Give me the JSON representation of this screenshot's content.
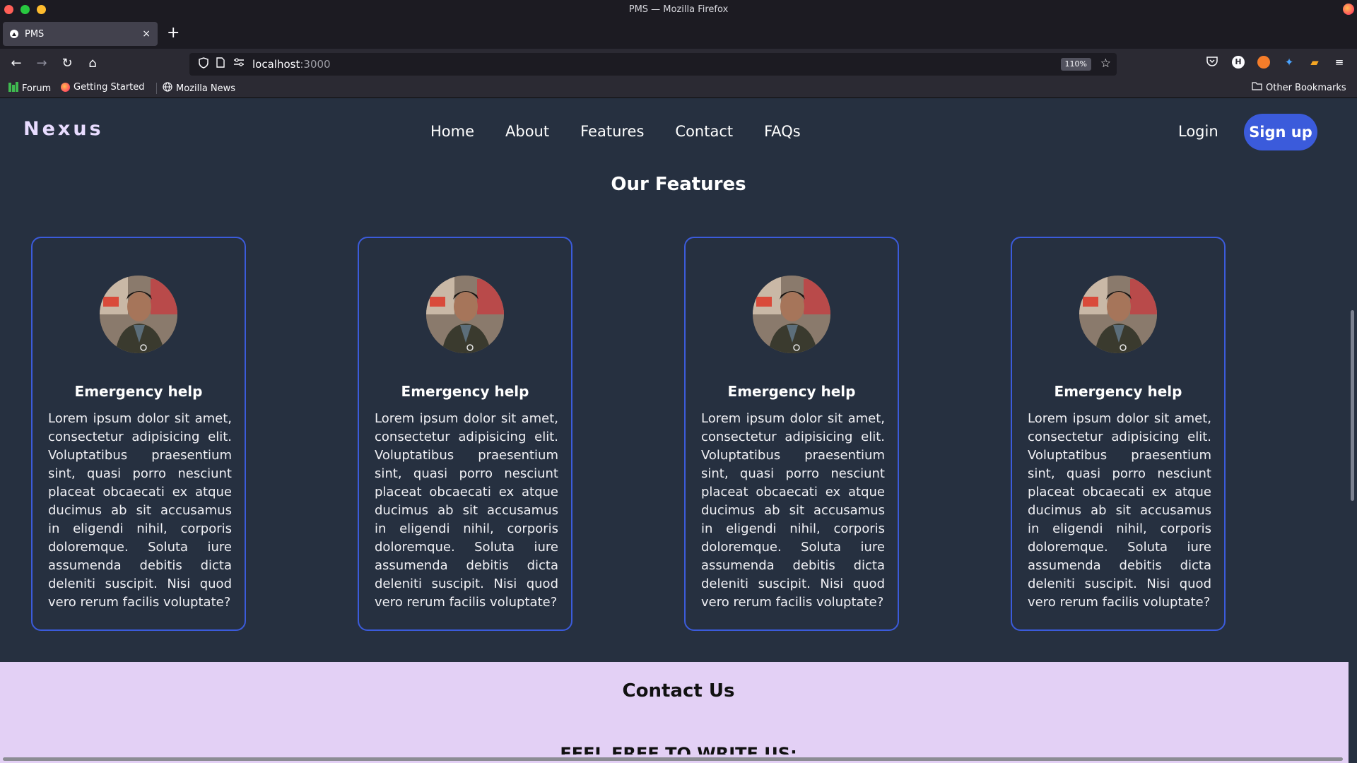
{
  "window": {
    "title": "PMS — Mozilla Firefox"
  },
  "tab": {
    "title": "PMS",
    "close": "×",
    "new_tab": "+"
  },
  "address": {
    "host": "localhost",
    "port": ":3000",
    "zoom": "110%"
  },
  "bookmarks": [
    {
      "label": "Forum"
    },
    {
      "label": "Getting Started"
    },
    {
      "label": "Mozilla News"
    }
  ],
  "other_bookmarks": "Other Bookmarks",
  "site": {
    "logo": "Nexus",
    "nav": [
      "Home",
      "About",
      "Features",
      "Contact",
      "FAQs"
    ],
    "login": "Login",
    "signup": "Sign up"
  },
  "features": {
    "title": "Our Features",
    "cards": [
      {
        "title": "Emergency help",
        "text": "Lorem ipsum dolor sit amet, consectetur adipisicing elit. Voluptatibus praesentium sint, quasi porro nesciunt placeat obcaecati ex atque ducimus ab sit accusamus in eligendi nihil, corporis doloremque. Soluta iure assumenda debitis dicta deleniti suscipit. Nisi quod vero rerum facilis voluptate?"
      },
      {
        "title": "Emergency help",
        "text": "Lorem ipsum dolor sit amet, consectetur adipisicing elit. Voluptatibus praesentium sint, quasi porro nesciunt placeat obcaecati ex atque ducimus ab sit accusamus in eligendi nihil, corporis doloremque. Soluta iure assumenda debitis dicta deleniti suscipit. Nisi quod vero rerum facilis voluptate?"
      },
      {
        "title": "Emergency help",
        "text": "Lorem ipsum dolor sit amet, consectetur adipisicing elit. Voluptatibus praesentium sint, quasi porro nesciunt placeat obcaecati ex atque ducimus ab sit accusamus in eligendi nihil, corporis doloremque. Soluta iure assumenda debitis dicta deleniti suscipit. Nisi quod vero rerum facilis voluptate?"
      },
      {
        "title": "Emergency help",
        "text": "Lorem ipsum dolor sit amet, consectetur adipisicing elit. Voluptatibus praesentium sint, quasi porro nesciunt placeat obcaecati ex atque ducimus ab sit accusamus in eligendi nihil, corporis doloremque. Soluta iure assumenda debitis dicta deleniti suscipit. Nisi quod vero rerum facilis voluptate?"
      }
    ]
  },
  "contact": {
    "title": "Contact Us",
    "subtitle": "FEEL FREE TO WRITE US:"
  },
  "colors": {
    "page_bg": "#263040",
    "accent": "#3b5bdb",
    "logo": "#e8dcff",
    "contact_bg": "#e3d0f5"
  },
  "icons": [
    "back-icon",
    "forward-icon",
    "reload-icon",
    "home-icon",
    "shield-icon",
    "page-icon",
    "permissions-icon",
    "star-icon",
    "pocket-icon",
    "folder-icon",
    "globe-icon",
    "menu-icon"
  ]
}
